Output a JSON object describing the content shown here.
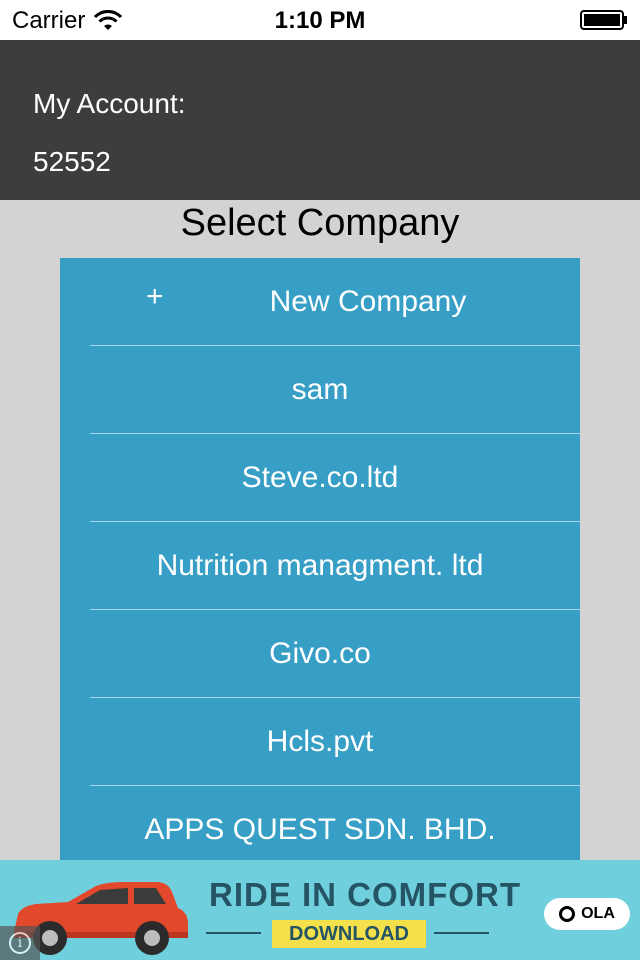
{
  "status_bar": {
    "carrier": "Carrier",
    "time": "1:10 PM"
  },
  "account": {
    "label": "My Account:",
    "number": "52552"
  },
  "section_title": "Select Company",
  "companies": {
    "new_symbol": "+",
    "new_label": "New Company",
    "items": [
      "sam",
      "Steve.co.ltd",
      "Nutrition managment. ltd",
      "Givo.co",
      "Hcls.pvt",
      "APPS QUEST SDN. BHD."
    ]
  },
  "ad": {
    "headline": "RIDE IN COMFORT",
    "cta": "DOWNLOAD",
    "brand": "OLA",
    "info_symbol": "i"
  },
  "colors": {
    "header_bg": "#3d3d3d",
    "list_bg": "#379fc6",
    "page_bg": "#d3d3d3",
    "ad_bg": "#6fcfdd",
    "ad_cta": "#f4e04a"
  }
}
